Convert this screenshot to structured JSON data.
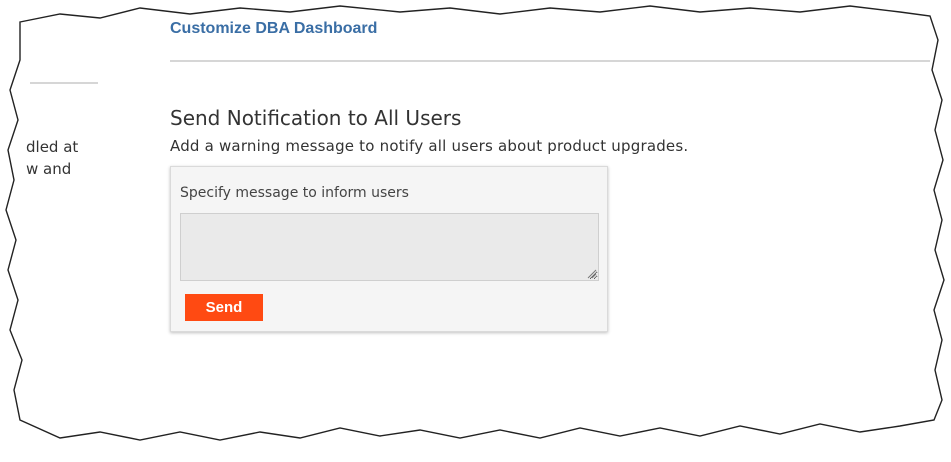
{
  "header": {
    "link_label": "Customize DBA Dashboard"
  },
  "left_panel": {
    "line1": "dled at",
    "line2": "w and"
  },
  "notification": {
    "title": "Send Notification to All Users",
    "description": "Add a warning message to notify all users about product upgrades.",
    "field_label": "Specify message to inform users",
    "message_value": "",
    "send_label": "Send"
  },
  "colors": {
    "link": "#3a6ea5",
    "send_button": "#ff4a12",
    "panel_background": "#f5f5f5",
    "textarea_background": "#eaeaea"
  }
}
